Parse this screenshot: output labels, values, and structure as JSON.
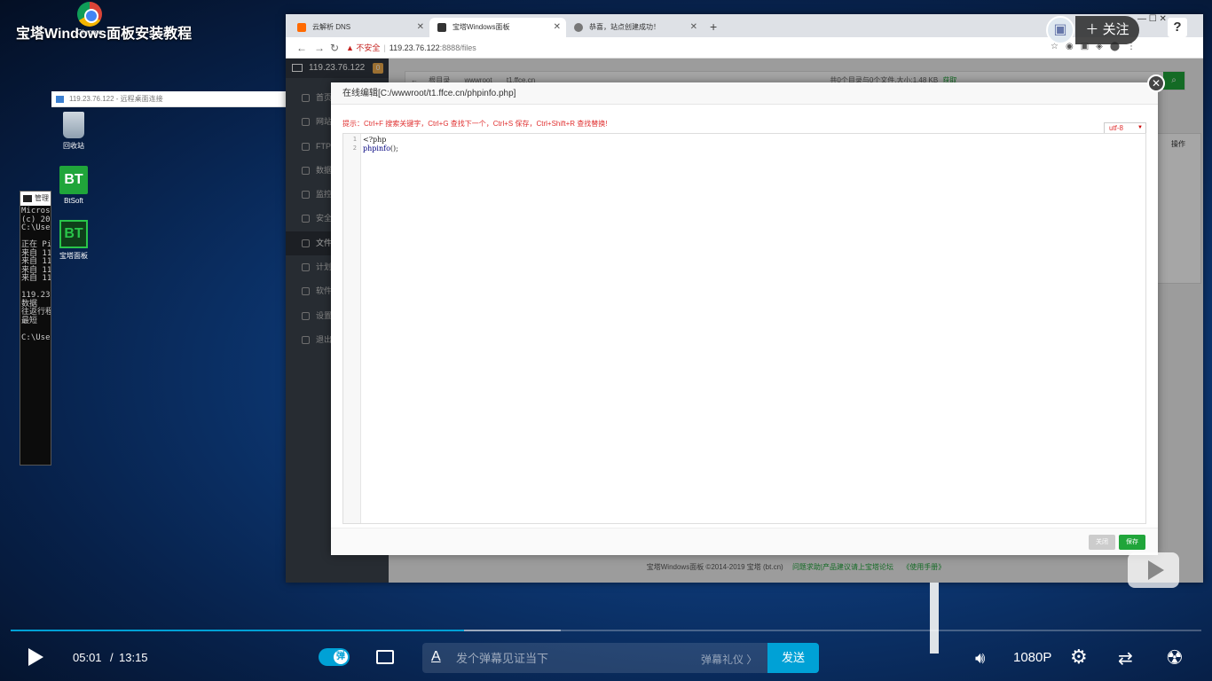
{
  "video": {
    "title": "宝塔Windows面板安装教程",
    "chrome_icon_label": "Chrome",
    "follow_label": "关注",
    "help_label": "?",
    "avatar_icon": "bilibili-tv-icon"
  },
  "rdp": {
    "title": "119.23.76.122 - 远程桌面连接",
    "icons": {
      "recycle": "回收站",
      "btsoft_img": "BT",
      "btsoft": "BtSoft",
      "btpanel_img": "BT",
      "btpanel": "宝塔面板"
    }
  },
  "cmd": {
    "title": "管理",
    "lines": [
      "Microso",
      "(c) 201",
      "",
      "C:\\User",
      "",
      "正在 Pi",
      "来自 11",
      "来自 11",
      "来自 11",
      "来自 11",
      "",
      "119.23.",
      "    数据",
      "往返行程",
      "    最短",
      "",
      "C:\\User"
    ]
  },
  "browser": {
    "tabs": [
      {
        "label": "云解析 DNS"
      },
      {
        "label": "宝塔Windows面板"
      },
      {
        "label": "恭喜，站点创建成功！"
      }
    ],
    "new_tab": "+",
    "window_controls": "—   ☐   ✕",
    "url_warning": "不安全",
    "url_host": "119.23.76.122",
    "url_path": ":8888/files"
  },
  "bt": {
    "server": "119.23.76.122",
    "badge": "0",
    "nav": [
      "首页",
      "网站",
      "FTP",
      "数据库",
      "监控",
      "安全",
      "文件",
      "计划任务",
      "软件商店",
      "设置",
      "退出"
    ],
    "active_nav": 6,
    "path_root": "根目录",
    "path_1": "wwwroot",
    "path_2": "t1.ffce.cn",
    "dir_summary": "共0个目录与0个文件,大小:1.48 KB",
    "dir_summary_link": "获取",
    "ops_header": "操作",
    "footer_text": "宝塔Windows面板 ©2014-2019 宝塔 (bt.cn)",
    "footer_link1": "问题求助|产品建议请上宝塔论坛",
    "footer_link2": "《使用手册》"
  },
  "editor": {
    "title": "在线编辑[C:/wwwroot/t1.ffce.cn/phpinfo.php]",
    "hint": "提示：Ctrl+F 搜索关键字，Ctrl+G 查找下一个，Ctrl+S 保存，Ctrl+Shift+R 查找替换!",
    "encoding": "utf-8",
    "line_numbers": [
      "1",
      "2"
    ],
    "code_line1": "<?php",
    "code_fn": "phpinfo",
    "code_tail": "();",
    "close_label": "关闭",
    "save_label": "保存"
  },
  "player": {
    "progress_played_fraction": 0.381,
    "progress_buffer_fraction": 0.462,
    "time_current": "05:01",
    "time_sep": "/",
    "time_total": "13:15",
    "danmaku_toggle_label": "弹",
    "danmaku_placeholder": "发个弹幕见证当下",
    "danmaku_etiquette": "弹幕礼仪 〉",
    "send_label": "发送",
    "quality": "1080P",
    "accent": "#00a1d6"
  }
}
